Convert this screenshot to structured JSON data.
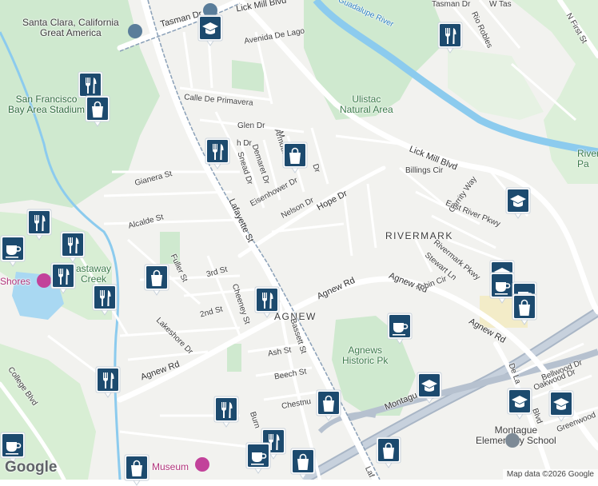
{
  "map": {
    "attribution": "Map data ©2026 Google",
    "logo_text": "Google",
    "colors": {
      "background": "#f2f2ef",
      "park": "#c8e6c9",
      "water": "#7fc4ea",
      "highway": "#a9b6c6",
      "road": "#ffffff",
      "marker": "#1c4a6e",
      "transit_line": "#7a8fa6"
    },
    "labels": {
      "great_america": "Santa Clara, California\nGreat America",
      "stadium": "San Francisco\nBay Area Stadium",
      "ulistac": "Ulistac\nNatural Area",
      "rivermark": "RIVERMARK",
      "agnews_park": "Agnews\nHistoric Pk",
      "montague_school": "Montague\nElementary School",
      "shores": "Shores",
      "castaway": "astaway\nCreek",
      "museum": "Museum",
      "river_pk": "River\nPa",
      "agnew_area": "AGNEW",
      "guadalupe_river": "Guadalupe River"
    },
    "streets": {
      "tasman_dr": "Tasman Dr",
      "tasman_dr_2": "Tasman Dr",
      "w_tas": "W Tas",
      "n_first": "N First St",
      "lick_mill_top": "Lick Mill Blvd",
      "lick_mill_mid": "Lick Mill Blvd",
      "avenida_de_lago": "Avenida De Lago",
      "rio_robles": "Rio Robles",
      "calle_de_primavera": "Calle De Primavera",
      "glen_dr": "Glen Dr",
      "fairway_dr": "h Dr",
      "snead_dr": "Snead Dr",
      "demaret_dr": "Demaret Dr",
      "armour_dr": "Armour Dr",
      "m_dr": "M",
      "dr_short": "Dr",
      "eisenhower_dr": "Eisenhower Dr",
      "nelson_dr": "Nelson Dr",
      "hope_dr": "Hope Dr",
      "gianera_st": "Gianera St",
      "alcalde_st": "Alcalde St",
      "lafayette_st": "Lafayette St",
      "fuller_st": "Fuller St",
      "third_st": "3rd St",
      "second_st": "2nd St",
      "cheeney_st": "Cheeney St",
      "lakeshore_dr": "Lakeshore Dr",
      "agnew_rd_left": "Agnew Rd",
      "agnew_rd_mid": "Agnew Rd",
      "agnew_rd_right": "Agnew Rd",
      "agnew_rd_far": "Agnew Rd",
      "bassett_st": "Bassett St",
      "ash_st": "Ash St",
      "beech_st": "Beech St",
      "chestnut": "Chestnu",
      "burn": "Burn",
      "college_blvd": "College Blvd",
      "billings_cir": "Billings Cir",
      "garrity_way": "Garrity Way",
      "east_river_pkwy": "East River Pkwy",
      "stewart_ln": "Stewart Ln",
      "tobin_cir": "Tobin Cir",
      "rivermark_pkwy": "Rivermark Pkwy",
      "montague": "Montague",
      "bellwood_dr": "Bellwood Dr",
      "oakwood_dr": "Oakwood Dr",
      "greenwood": "Greenwood",
      "de_la_cruz": "De La",
      "blvd_lower": "Blvd",
      "laf_lower": "Laf"
    },
    "markers": [
      {
        "type": "restaurant",
        "name": "restaurant-marker"
      },
      {
        "type": "shopping",
        "name": "shopping-marker"
      },
      {
        "type": "school",
        "name": "school-marker"
      },
      {
        "type": "cafe",
        "name": "cafe-marker"
      }
    ]
  }
}
